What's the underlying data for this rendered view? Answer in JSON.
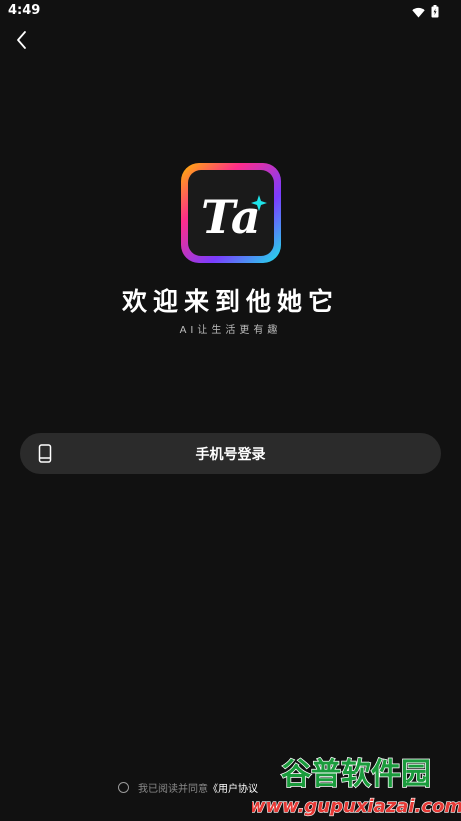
{
  "status_bar": {
    "time": "4:49",
    "wifi_icon": "wifi-icon",
    "battery_icon": "battery-icon"
  },
  "nav": {
    "back_icon": "chevron-left-icon"
  },
  "app": {
    "logo_text": "Ta",
    "title": "欢迎来到他她它",
    "slogan": "AI让生活更有趣"
  },
  "login": {
    "phone_button_label": "手机号登录",
    "phone_icon": "smartphone-icon"
  },
  "agreement": {
    "prefix": "我已阅读并同意",
    "link_label": "《用户协议"
  },
  "watermark": {
    "brand_text": "谷普软件园",
    "url_text": "www.gupuxiazai.com"
  },
  "colors": {
    "background": "#111111",
    "button_background": "#2b2b2b",
    "logo_gradient": [
      "#ff2d8a",
      "#ffb800",
      "#7b3cff",
      "#1ee3e9"
    ],
    "watermark_brand": "#1a9b3c",
    "watermark_url": "#e53935"
  }
}
